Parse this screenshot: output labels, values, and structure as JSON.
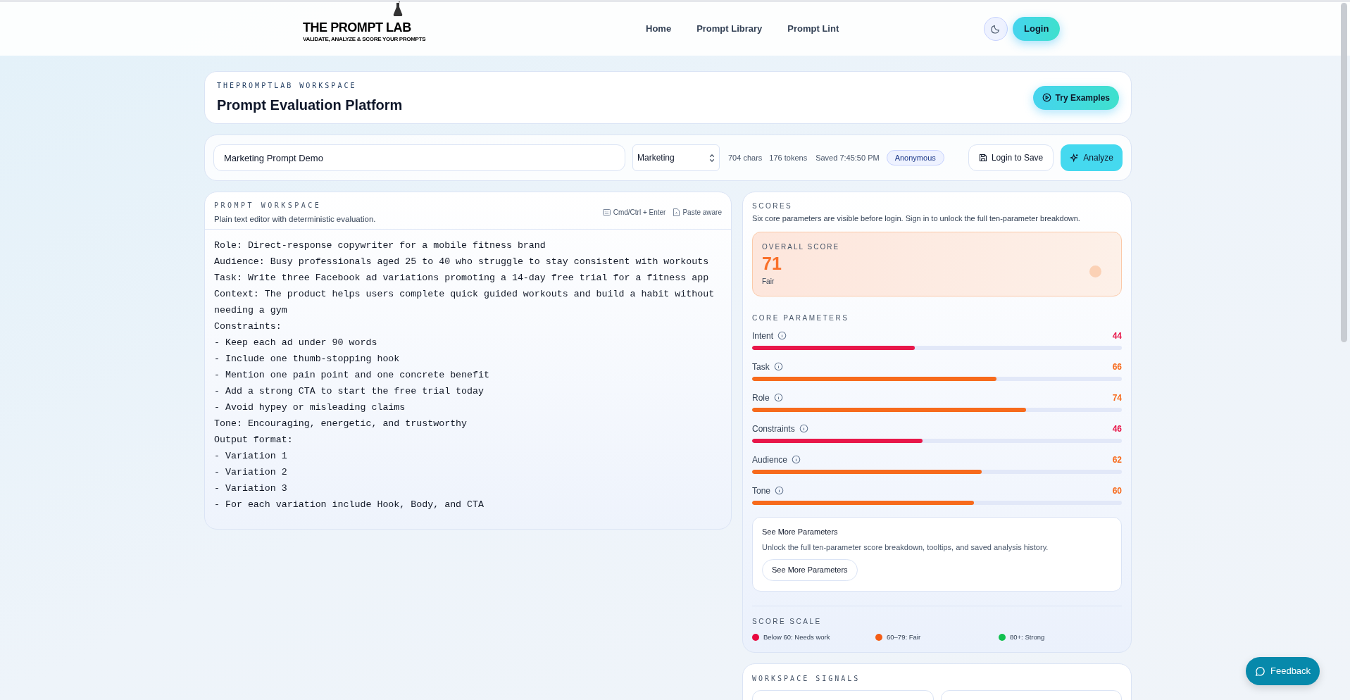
{
  "header": {
    "logo_title": "THE PROMPT LAB",
    "logo_tagline": "VALIDATE, ANALYZE & SCORE YOUR PROMPTS",
    "nav": [
      {
        "label": "Home"
      },
      {
        "label": "Prompt Library"
      },
      {
        "label": "Prompt Lint"
      }
    ],
    "login": "Login"
  },
  "workspace_header": {
    "eyebrow": "THEPROMPTLAB WORKSPACE",
    "title": "Prompt Evaluation Platform",
    "try_examples": "Try Examples"
  },
  "toolbar": {
    "prompt_name": "Marketing Prompt Demo",
    "category": "Marketing",
    "chars": "704 chars",
    "tokens": "176 tokens",
    "saved": "Saved 7:45:50 PM",
    "user_badge": "Anonymous",
    "login_to_save": "Login to Save",
    "analyze": "Analyze"
  },
  "editor": {
    "eyebrow": "PROMPT WORKSPACE",
    "subtitle": "Plain text editor with deterministic evaluation.",
    "hints": [
      "Cmd/Ctrl + Enter",
      "Paste aware"
    ],
    "lines": [
      "Role: Direct-response copywriter for a mobile fitness brand",
      "Audience: Busy professionals aged 25 to 40 who struggle to stay consistent with workouts",
      "Task: Write three Facebook ad variations promoting a 14-day free trial for a fitness app",
      "Context: The product helps users complete quick guided workouts and build a habit without",
      "needing a gym",
      "Constraints:",
      "- Keep each ad under 90 words",
      "- Include one thumb-stopping hook",
      "- Mention one pain point and one concrete benefit",
      "- Add a strong CTA to start the free trial today",
      "- Avoid hypey or misleading claims",
      "Tone: Encouraging, energetic, and trustworthy",
      "Output format:",
      "- Variation 1",
      "- Variation 2",
      "- Variation 3",
      "- For each variation include Hook, Body, and CTA"
    ]
  },
  "scores": {
    "eyebrow": "SCORES",
    "subtitle": "Six core parameters are visible before login. Sign in to unlock the full ten-parameter breakdown.",
    "overall": {
      "label": "OVERALL SCORE",
      "value": "71",
      "rating": "Fair"
    },
    "core_title": "CORE PARAMETERS",
    "parameters": [
      {
        "name": "Intent",
        "score": "44",
        "level": 0.44,
        "color": "#e8174a"
      },
      {
        "name": "Task",
        "score": "66",
        "level": 0.66,
        "color": "#f76a1c"
      },
      {
        "name": "Role",
        "score": "74",
        "level": 0.74,
        "color": "#f76a1c"
      },
      {
        "name": "Constraints",
        "score": "46",
        "level": 0.46,
        "color": "#e8174a"
      },
      {
        "name": "Audience",
        "score": "62",
        "level": 0.62,
        "color": "#f76a1c"
      },
      {
        "name": "Tone",
        "score": "60",
        "level": 0.6,
        "color": "#f76a1c"
      }
    ],
    "more": {
      "title": "See More Parameters",
      "text": "Unlock the full ten-parameter score breakdown, tooltips, and saved analysis history.",
      "button": "See More Parameters"
    },
    "scale_title": "SCORE SCALE",
    "scale": [
      {
        "label": "Below 60: Needs work",
        "color": "#e8073f"
      },
      {
        "label": "60–79: Fair",
        "color": "#f45d16"
      },
      {
        "label": "80+: Strong",
        "color": "#11c04f"
      }
    ]
  },
  "signals": {
    "eyebrow": "WORKSPACE SIGNALS"
  },
  "feedback": "Feedback"
}
